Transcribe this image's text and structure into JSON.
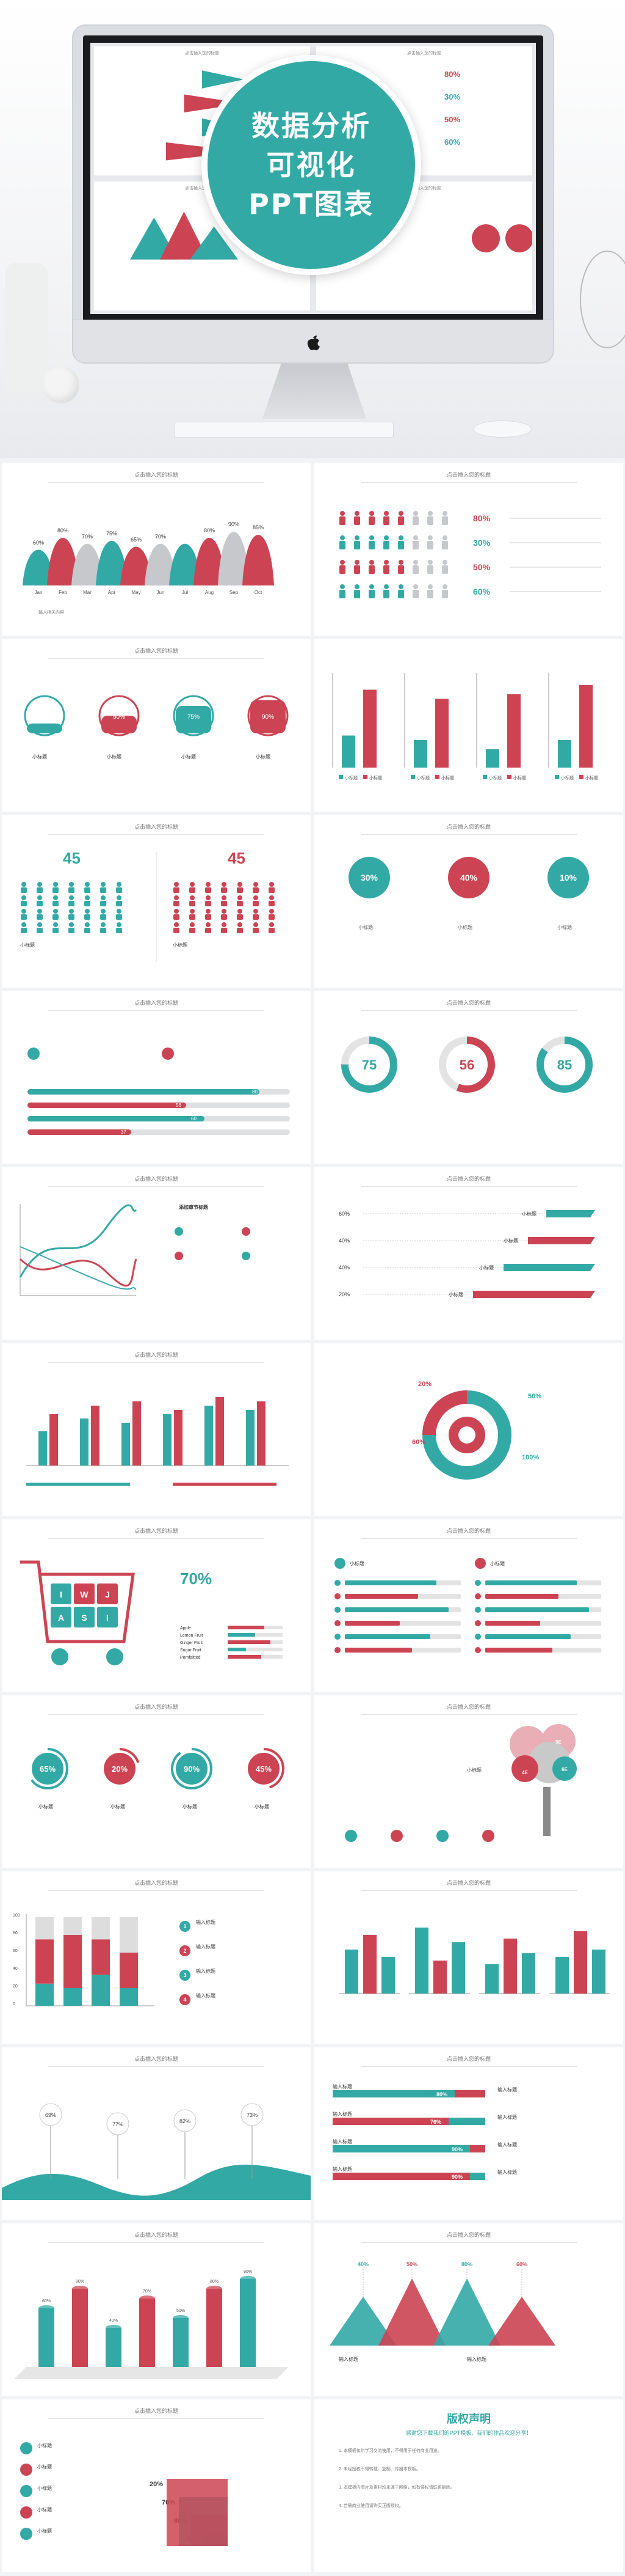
{
  "hero": {
    "title_line1": "数据分析",
    "title_line2": "可视化",
    "title_line3": "PPT图表",
    "mini_caption": "点击插入您的标题",
    "mini_percents": [
      "80%",
      "30%",
      "50%",
      "60%"
    ]
  },
  "slide_title": "点击插入您的标题",
  "desc": "输入相关内容",
  "sub_label": "小标题",
  "input_title": "输入标题",
  "colors": {
    "teal": "#33a9a6",
    "red": "#cc4453",
    "grey": "#c6c8cc"
  },
  "s1": {
    "months": [
      "Jan",
      "Feb",
      "Mar",
      "Apr",
      "May",
      "Jun",
      "Jul",
      "Aug",
      "Sep",
      "Oct"
    ],
    "values": [
      60,
      80,
      70,
      75,
      65,
      70,
      70,
      80,
      90,
      85
    ],
    "labels": [
      "60%",
      "80%",
      "70%",
      "75%",
      "65%",
      "70%",
      "",
      "80%",
      "90%",
      "85%"
    ]
  },
  "s2": {
    "percents": [
      "80%",
      "30%",
      "50%",
      "60%"
    ]
  },
  "s3": {
    "percents": [
      "30%",
      "50%",
      "75%",
      "90%"
    ]
  },
  "s5": {
    "male": "45",
    "female": "45"
  },
  "s6": {
    "percents": [
      "30%",
      "40%",
      "10%"
    ]
  },
  "s7": {
    "bars": [
      "80",
      "56",
      "60",
      "37"
    ]
  },
  "s8": {
    "rings": [
      "75",
      "56",
      "85"
    ]
  },
  "s9": {
    "title": "添加章节标题"
  },
  "s10": {
    "percents": [
      "60%",
      "40%",
      "40%",
      "20%"
    ]
  },
  "s12": {
    "percents": [
      "20%",
      "50%",
      "60%",
      "100%"
    ]
  },
  "s13": {
    "big": "70%",
    "letters": [
      "I",
      "W",
      "J",
      "A",
      "S",
      "I"
    ],
    "items": [
      "Apple",
      "Lemon Fruit",
      "Ginger Fruit",
      "Sugar Fruit",
      "Pomfaitted"
    ]
  },
  "s15": {
    "rings": [
      "65%",
      "20%",
      "90%",
      "45%"
    ]
  },
  "s16": {
    "badges": [
      "4E",
      "5E",
      "6E"
    ]
  },
  "s17": {
    "steps": [
      "1",
      "2",
      "3",
      "4"
    ],
    "yticks": [
      "100",
      "80",
      "60",
      "40",
      "20",
      "0"
    ]
  },
  "s19": {
    "peaks": [
      "69%",
      "77%",
      "82%",
      "73%"
    ]
  },
  "s20": {
    "bars": [
      "80%",
      "76%",
      "90%",
      "90%"
    ]
  },
  "s21": {
    "labels": [
      "60%",
      "80%",
      "40%",
      "70%",
      "50%",
      "80%",
      "90%"
    ]
  },
  "s22": {
    "peaks": [
      "40%",
      "50%",
      "80%",
      "60%"
    ]
  },
  "s23": {
    "steps": [
      "90%",
      "80%",
      "70%",
      "20%"
    ]
  },
  "s24": {
    "title": "版权声明",
    "subtitle": "感谢您下载我们的PPT模板，我们的作品欢迎分享！",
    "paras": [
      "1. 本模板仅供学习交流使用，不得用于任何商业用途。",
      "2. 未经授权不得转载、复制、传播本模板。",
      "3. 本模板内图片及素材均来源于网络，如有侵权请联系删除。",
      "4. 若需商业使用请购买正版授权。"
    ]
  }
}
